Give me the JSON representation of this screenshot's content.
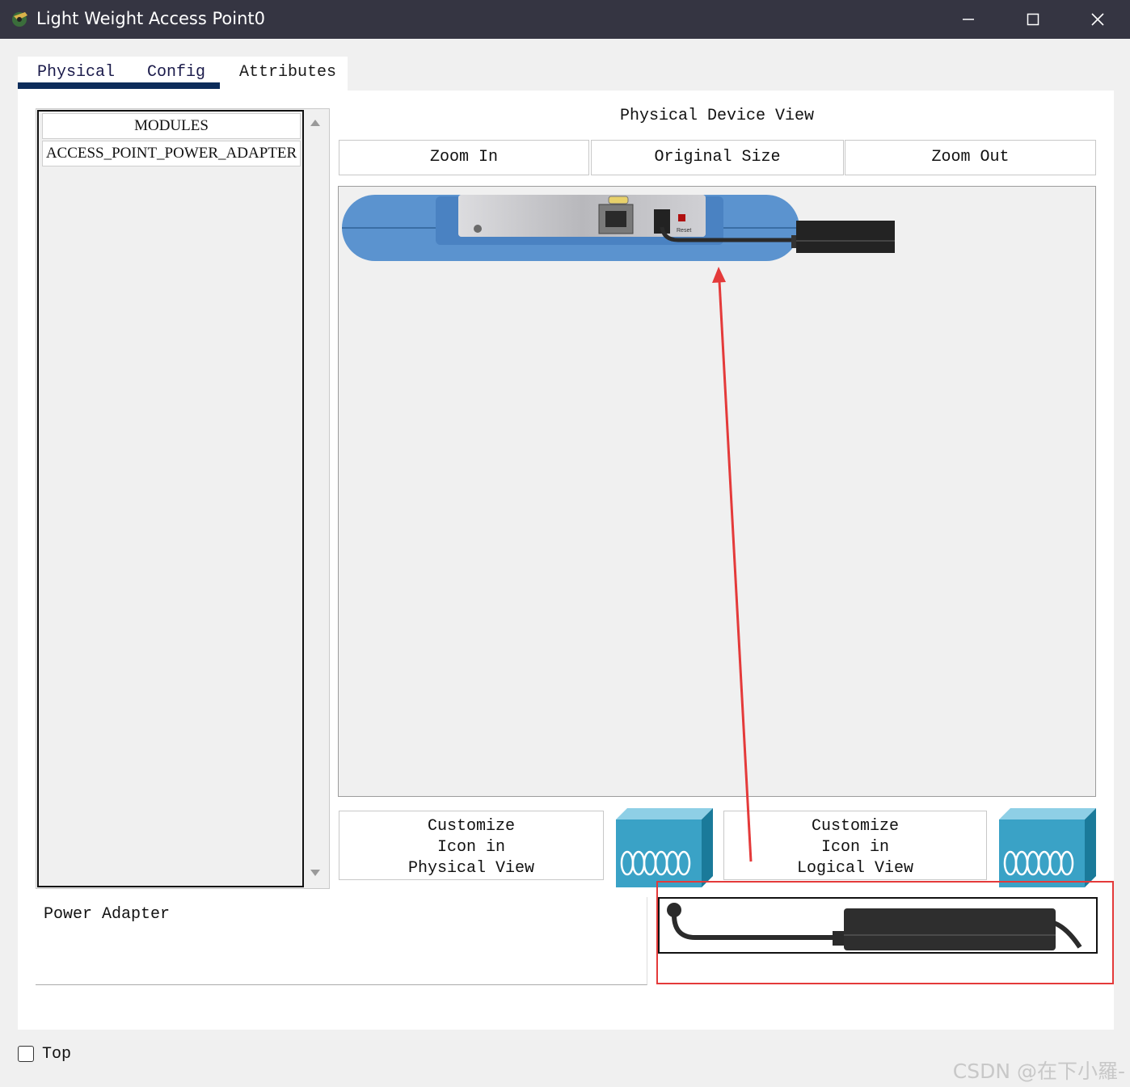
{
  "window": {
    "title": "Light Weight Access Point0",
    "controls": [
      "minimize-icon",
      "maximize-icon",
      "close-icon"
    ]
  },
  "tabs": [
    {
      "label": "Physical",
      "selected": true
    },
    {
      "label": "Config",
      "selected": false
    },
    {
      "label": "Attributes",
      "selected": false
    }
  ],
  "modules": {
    "header": "MODULES",
    "items": [
      "ACCESS_POINT_POWER_ADAPTER"
    ]
  },
  "physical_view": {
    "title": "Physical Device View",
    "zoom_in": "Zoom In",
    "original_size": "Original Size",
    "zoom_out": "Zoom Out",
    "device_label": "Reset"
  },
  "customize": {
    "physical": [
      "Customize",
      "Icon in",
      "Physical View"
    ],
    "logical": [
      "Customize",
      "Icon in",
      "Logical View"
    ]
  },
  "description": "Power Adapter",
  "footer": {
    "top_label": "Top",
    "top_checked": false
  },
  "watermark": "CSDN @在下小羅-",
  "colors": {
    "titlebar": "#353542",
    "tab_underline": "#0c2c5a",
    "annotation": "#e43a3a",
    "device_blue": "#5b93cf"
  }
}
